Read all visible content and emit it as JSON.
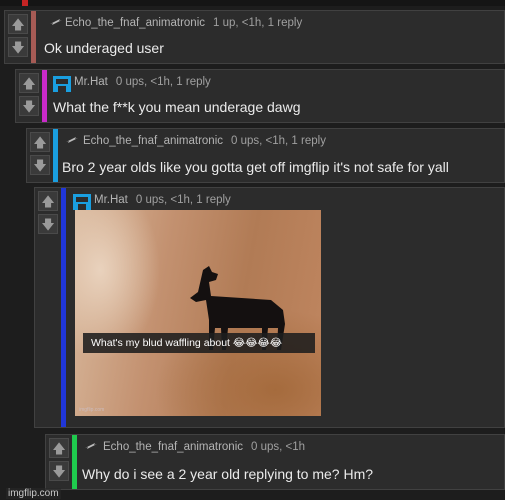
{
  "comments": [
    {
      "username": "Echo_the_fnaf_animatronic",
      "meta": "1 up, <1h, 1 reply",
      "body": "Ok underaged user",
      "bar_color": "#a65b55"
    },
    {
      "username": "Mr.Hat",
      "meta": "0 ups, <1h, 1 reply",
      "body": "What the f**k you mean underage dawg",
      "bar_color": "#c92ac9"
    },
    {
      "username": "Echo_the_fnaf_animatronic",
      "meta": "0 ups, <1h, 1 reply",
      "body": "Bro 2 year olds like you gotta get off imgflip it's not safe for yall",
      "bar_color": "#1a9fe0"
    },
    {
      "username": "Mr.Hat",
      "meta": "0 ups, <1h, 1 reply",
      "bar_color": "#2036d8",
      "image": {
        "caption": "What's my blud waffling about 😂😂😂😂",
        "watermark": "imgflip.com"
      }
    },
    {
      "username": "Echo_the_fnaf_animatronic",
      "meta": "0 ups, <1h",
      "body": "Why do i see a 2 year old replying to me? Hm?",
      "bar_color": "#1fcb4e"
    }
  ],
  "site_watermark": "imgflip.com",
  "icons": {
    "upvote": "arrow-up-icon",
    "downvote": "arrow-down-icon",
    "avatar_echo": "echo-avatar-icon",
    "avatar_hat": "mr-hat-avatar-icon"
  }
}
